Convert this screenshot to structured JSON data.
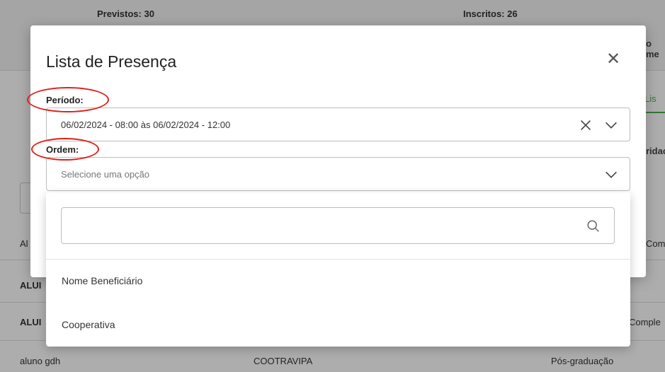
{
  "background": {
    "previstos_label": "Previstos: 30",
    "inscritos_label": "Inscritos: 26",
    "right_partial_1": "o me",
    "right_partial_2": "Lis",
    "right_partial_3": "ridac",
    "right_partial_4": "Com",
    "right_partial_5": "Comple",
    "row_left_partial_1": "Al",
    "row_left_partial_2": "ALUI",
    "row_left_partial_3": "ALUI",
    "last_row": {
      "name": "aluno gdh",
      "cooperative": "COOTRAVIPA",
      "level": "Pós-graduação"
    }
  },
  "modal": {
    "title": "Lista de Presença",
    "close_icon": "close-icon",
    "periodo": {
      "label": "Período:",
      "value": "06/02/2024 - 08:00 às 06/02/2024 - 12:00"
    },
    "ordem": {
      "label": "Ordem:",
      "placeholder": "Selecione uma opção"
    }
  },
  "dropdown": {
    "search_value": "",
    "search_icon": "search-icon",
    "options": [
      "Nome Beneficiário",
      "Cooperativa"
    ]
  },
  "colors": {
    "annotation_red": "#e0201b",
    "accent_green": "#4caf50"
  }
}
